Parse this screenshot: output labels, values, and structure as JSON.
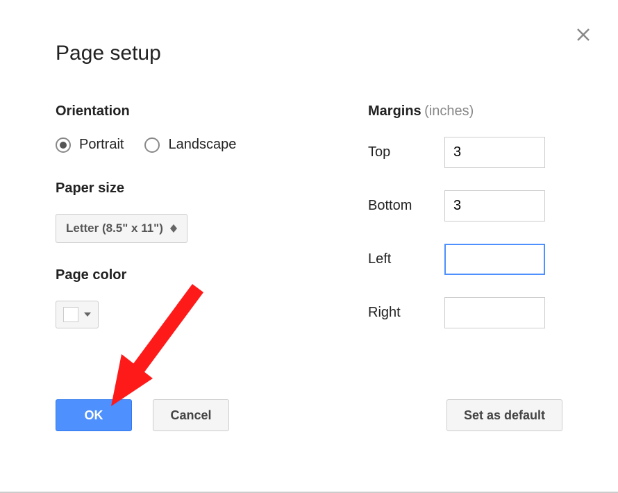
{
  "dialog": {
    "title": "Page setup"
  },
  "orientation": {
    "label": "Orientation",
    "portrait": "Portrait",
    "landscape": "Landscape",
    "selected": "portrait"
  },
  "paperSize": {
    "label": "Paper size",
    "value": "Letter (8.5\" x 11\")"
  },
  "pageColor": {
    "label": "Page color",
    "color": "#ffffff"
  },
  "margins": {
    "label": "Margins",
    "unit": "(inches)",
    "top": {
      "label": "Top",
      "value": "3"
    },
    "bottom": {
      "label": "Bottom",
      "value": "3"
    },
    "left": {
      "label": "Left",
      "value": ""
    },
    "right": {
      "label": "Right",
      "value": ""
    }
  },
  "buttons": {
    "ok": "OK",
    "cancel": "Cancel",
    "setDefault": "Set as default"
  }
}
